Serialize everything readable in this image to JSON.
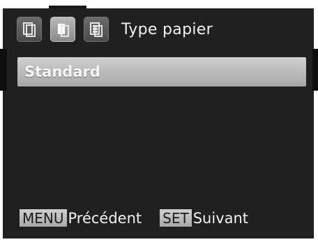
{
  "header": {
    "tabs": [
      {
        "icon": "single-page-icon"
      },
      {
        "icon": "paper-type-icon"
      },
      {
        "icon": "layout-grid-icon"
      }
    ],
    "title": "Type papier"
  },
  "list": {
    "selected": "Standard"
  },
  "footer": {
    "menu_key": "MENU",
    "menu_label": "Précédent",
    "set_key": "SET",
    "set_label": "Suivant"
  }
}
